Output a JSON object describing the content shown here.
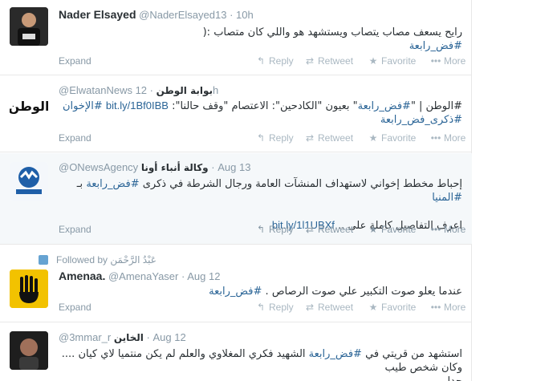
{
  "tweets": [
    {
      "name": "Nader Elsayed",
      "screen": "@NaderElsayed13",
      "time": "10h",
      "line1": "رايح يسعف مصاب يتصاب ويستشهد هو واللي كان متصاب :(",
      "hashtag1": "#فض_رابعة",
      "actions": {
        "expand": "Expand",
        "reply": "Reply",
        "retweet": "Retweet",
        "favorite": "Favorite",
        "more": "More"
      }
    },
    {
      "name": "بوابة الوطن",
      "screen": "@ElwatanNews",
      "time": "12h",
      "line1_pre": "#الوطن | \"",
      "hashtag1": "#فض_رابعة",
      "line1_mid": "\" بعيون \"الكادحين\": الاعتصام \"وقف حالنا\": ",
      "link": "bit.ly/1Bf0IBB",
      "hashtag2": "#الإخوان",
      "hashtag3": "#ذكرى_فض_رابعة",
      "actions": {
        "expand": "Expand",
        "reply": "Reply",
        "retweet": "Retweet",
        "favorite": "Favorite",
        "more": "More"
      }
    },
    {
      "name": "وكالة أنباء أونا",
      "screen": "@ONewsAgency",
      "time": "Aug 13",
      "line1_pre": "إحباط مخطط إخواني لاستهداف المنشآت العامة ورجال الشرطة في ذكرى ",
      "hashtag1": "#فض_رابعة",
      "line1_mid": " بـ ",
      "hashtag2": "#المنيا",
      "line2_pre": "اعرف التفاصيل كاملة على .. ",
      "link": "bit.ly/1l1UBXf",
      "actions": {
        "expand": "Expand",
        "reply": "Reply",
        "retweet": "Retweet",
        "favorite": "Favorite",
        "more": "More"
      }
    },
    {
      "followed_by": "Followed by عَبْدُ الرَّحْمَن",
      "name": "Amenaa.",
      "screen": "@AmenaYaser",
      "time": "Aug 12",
      "line1": "عندما يعلو صوت التكبير علي صوت الرصاص . ",
      "hashtag1": "#فض_رابعة",
      "actions": {
        "expand": "Expand",
        "reply": "Reply",
        "retweet": "Retweet",
        "favorite": "Favorite",
        "more": "More"
      }
    },
    {
      "name": "الخاين",
      "screen": "@3mmar_r",
      "time": "Aug 12",
      "line1_pre": "استشهد من قريتي في ",
      "hashtag1": "#فض_رابعة",
      "line1_post": " الشهيد فكري المغلاوي والعلم لم يكن منتميا لاي كيان .... وكان شخص طيب",
      "line2": "جدا"
    }
  ],
  "colors": {
    "accent": "#2a6496",
    "muted": "#8899a6",
    "highlight_bg": "#f5f8fa"
  },
  "icons": {
    "reply": "reply-icon",
    "retweet": "retweet-icon",
    "favorite": "star-icon",
    "more": "more-icon",
    "followed": "person-icon"
  }
}
